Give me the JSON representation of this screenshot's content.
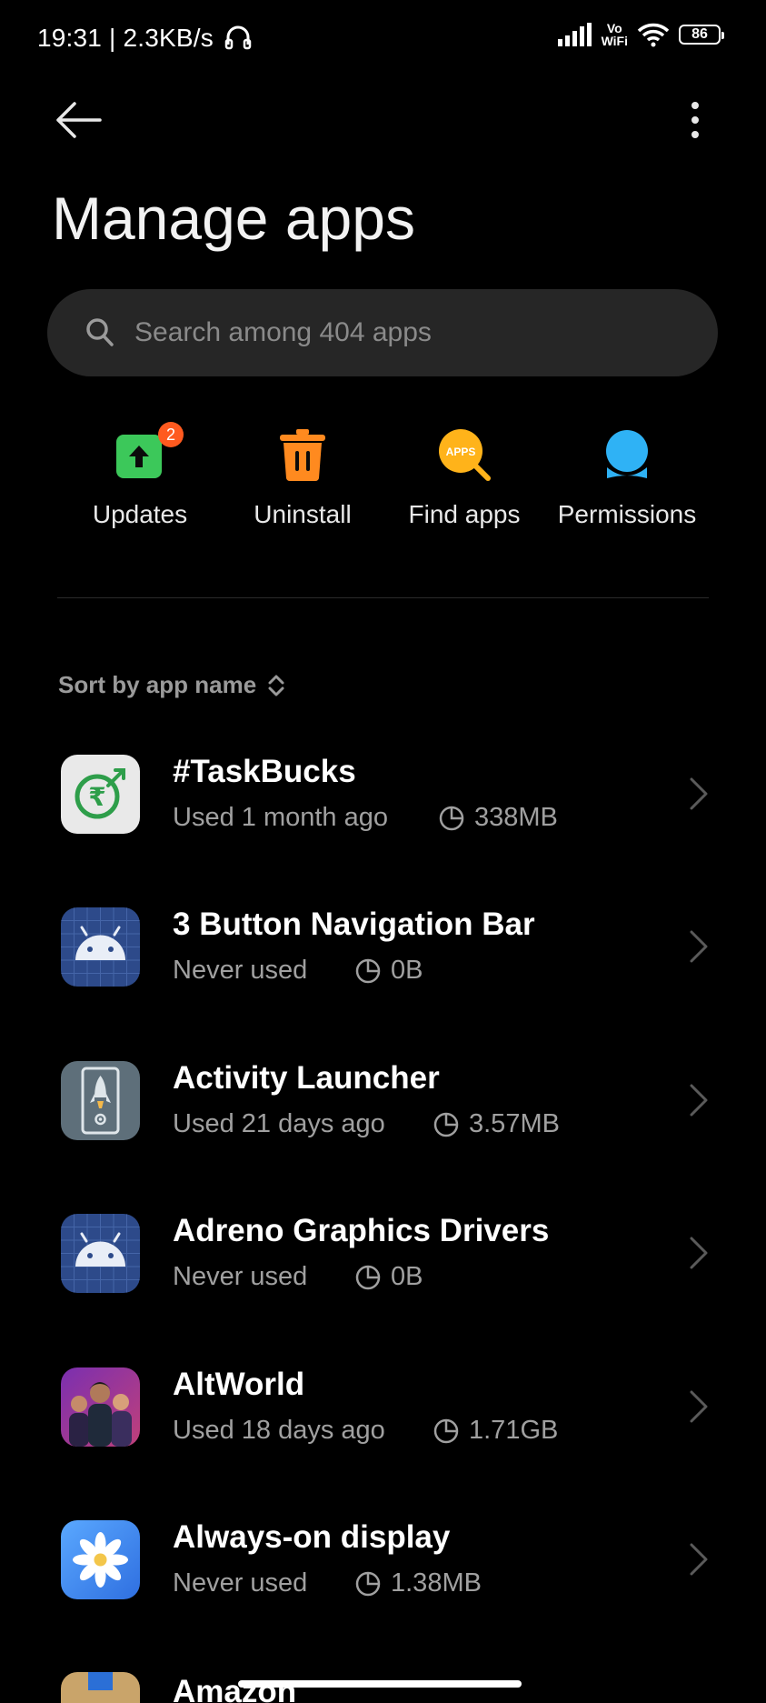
{
  "status_bar": {
    "time_speed": "19:31 | 2.3KB/s",
    "vowifi_top": "Vo",
    "vowifi_bottom": "WiFi",
    "battery": "86"
  },
  "header": {
    "title": "Manage apps"
  },
  "search": {
    "placeholder": "Search among 404 apps"
  },
  "quick_actions": [
    {
      "label": "Updates",
      "badge": "2",
      "icon": "update-arrow-icon",
      "color": "#3cc85a"
    },
    {
      "label": "Uninstall",
      "icon": "trash-icon",
      "color": "#ff8a1f"
    },
    {
      "label": "Find apps",
      "icon": "find-apps-icon",
      "icon_text": "APPS",
      "color": "#ffb31a"
    },
    {
      "label": "Permissions",
      "icon": "permissions-icon",
      "color": "#2fb2f5"
    }
  ],
  "sort": {
    "label": "Sort by app name"
  },
  "apps": [
    {
      "name": "#TaskBucks",
      "usage": "Used 1 month ago",
      "size": "338MB",
      "icon": "taskbucks-icon"
    },
    {
      "name": "3 Button Navigation Bar",
      "usage": "Never used",
      "size": "0B",
      "icon": "android-icon"
    },
    {
      "name": "Activity Launcher",
      "usage": "Used 21 days ago",
      "size": "3.57MB",
      "icon": "activity-launcher-icon"
    },
    {
      "name": "Adreno Graphics Drivers",
      "usage": "Never used",
      "size": "0B",
      "icon": "android-icon"
    },
    {
      "name": "AltWorld",
      "usage": "Used 18 days ago",
      "size": "1.71GB",
      "icon": "altworld-icon"
    },
    {
      "name": "Always-on display",
      "usage": "Never used",
      "size": "1.38MB",
      "icon": "always-on-display-icon"
    },
    {
      "name": "Amazon",
      "icon": "amazon-icon"
    }
  ]
}
